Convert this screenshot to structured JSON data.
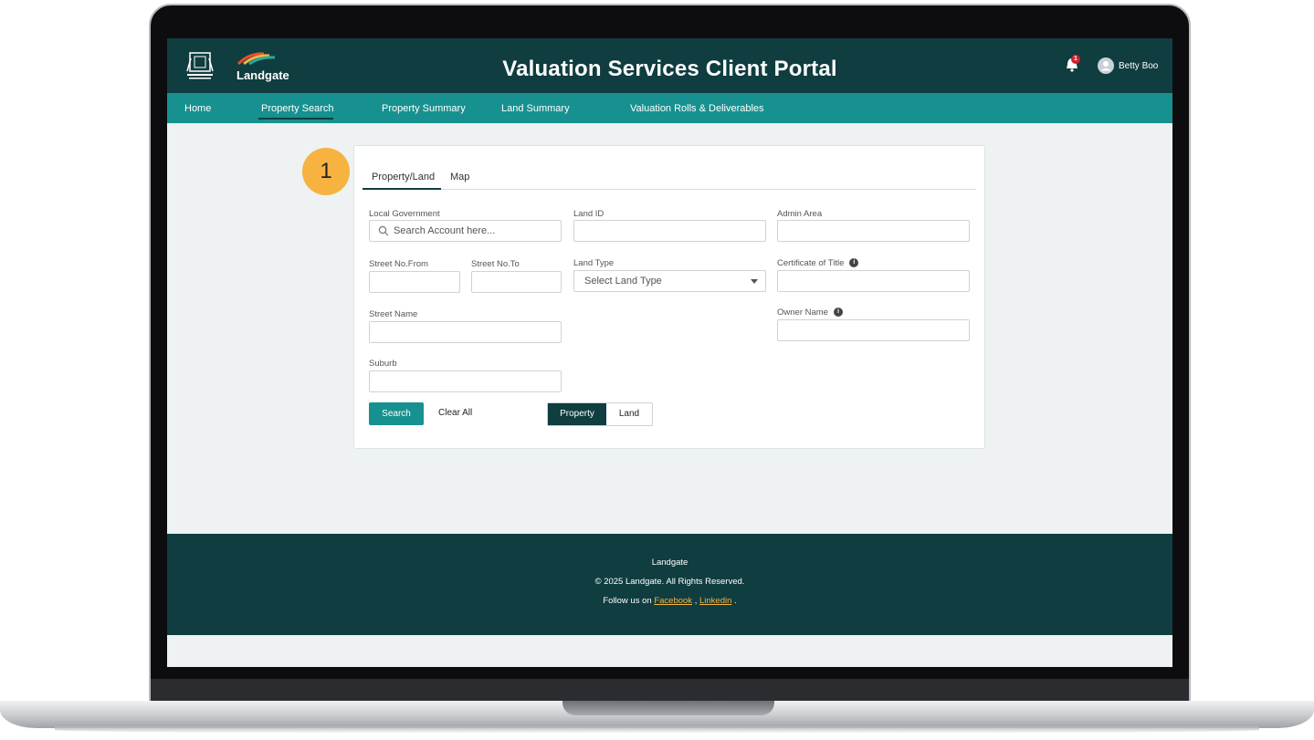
{
  "header": {
    "title": "Valuation Services Client Portal",
    "brand": "Landgate",
    "notification_count": "1",
    "user_name": "Betty Boo"
  },
  "nav": {
    "items": [
      "Home",
      "Property Search",
      "Property Summary",
      "Land Summary",
      "Valuation Rolls & Deliverables"
    ],
    "active": "Property Search"
  },
  "step_badge": "1",
  "tabs": [
    "Property/Land",
    "Map"
  ],
  "form": {
    "local_government": {
      "label": "Local Government",
      "placeholder": "Search Account here..."
    },
    "land_id": {
      "label": "Land ID"
    },
    "admin_area": {
      "label": "Admin Area"
    },
    "street_no_from": {
      "label": "Street No.From"
    },
    "street_no_to": {
      "label": "Street No.To"
    },
    "land_type": {
      "label": "Land Type",
      "value": "Select Land Type"
    },
    "certificate_of_title": {
      "label": "Certificate of Title"
    },
    "street_name": {
      "label": "Street Name"
    },
    "owner_name": {
      "label": "Owner Name"
    },
    "suburb": {
      "label": "Suburb"
    }
  },
  "actions": {
    "search_label": "Search",
    "clear_label": "Clear All",
    "toggle": [
      "Property",
      "Land"
    ]
  },
  "footer": {
    "brand": "Landgate",
    "copyright": "© 2025 Landgate. All Rights Reserved.",
    "follow_prefix": "Follow us on",
    "facebook": "Facebook",
    "linkedin": "Linkedin",
    "sep": ",",
    "end": "."
  },
  "colors": {
    "header_bg": "#0f3d40",
    "nav_bg": "#17918f",
    "accent": "#f6b33f"
  }
}
